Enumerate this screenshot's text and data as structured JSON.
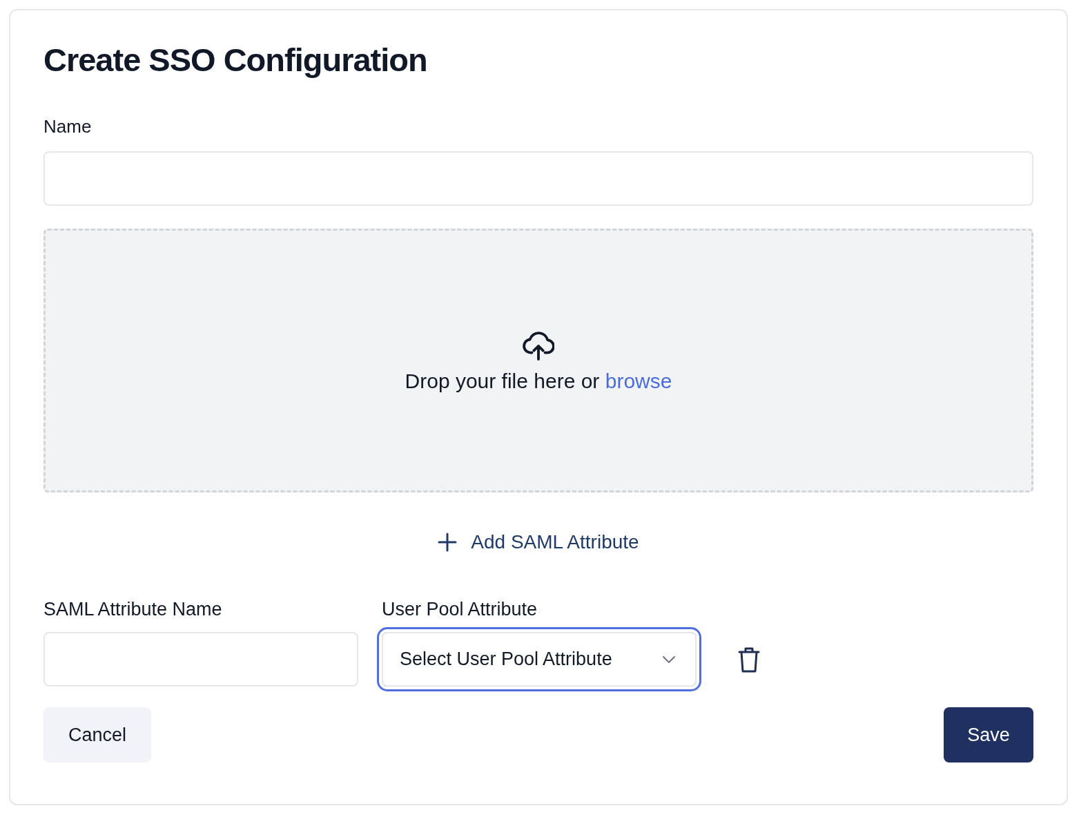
{
  "title": "Create SSO Configuration",
  "name_field": {
    "label": "Name"
  },
  "dropzone": {
    "text": "Drop your file here or",
    "link": "browse"
  },
  "add_attribute": {
    "label": "Add SAML Attribute"
  },
  "attributes": {
    "saml_label": "SAML Attribute Name",
    "pool_label": "User Pool Attribute",
    "rows": [
      {
        "pool_select": {
          "placeholder": "Select User Pool Attribute",
          "focused": true
        }
      }
    ]
  },
  "buttons": {
    "cancel": "Cancel",
    "save": "Save"
  }
}
